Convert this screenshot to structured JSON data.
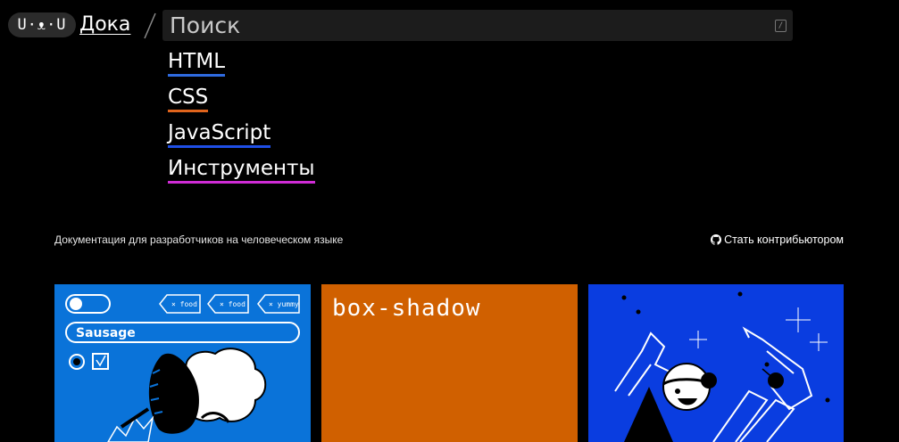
{
  "header": {
    "logo_text": "U·ᴥ·U",
    "site_name": "Дока",
    "search": {
      "placeholder": "Поиск",
      "shortcut": "/"
    }
  },
  "nav": [
    {
      "label": "HTML",
      "color": "#2f6be0"
    },
    {
      "label": "CSS",
      "color": "#e0641c"
    },
    {
      "label": "JavaScript",
      "color": "#1f4fe6"
    },
    {
      "label": "Инструменты",
      "color": "#d02cd6"
    }
  ],
  "tagline": "Документация для разработчиков на человеческом языке",
  "contribute": {
    "label": "Стать контрибьютором",
    "icon": "github-icon"
  },
  "cards": [
    {
      "tags": [
        "food",
        "food",
        "yummy"
      ],
      "input_value": "Sausage",
      "bg": "#0a73d9"
    },
    {
      "title": "box-shadow",
      "bg": "#d06000"
    },
    {
      "bg": "#0a3de0"
    }
  ]
}
